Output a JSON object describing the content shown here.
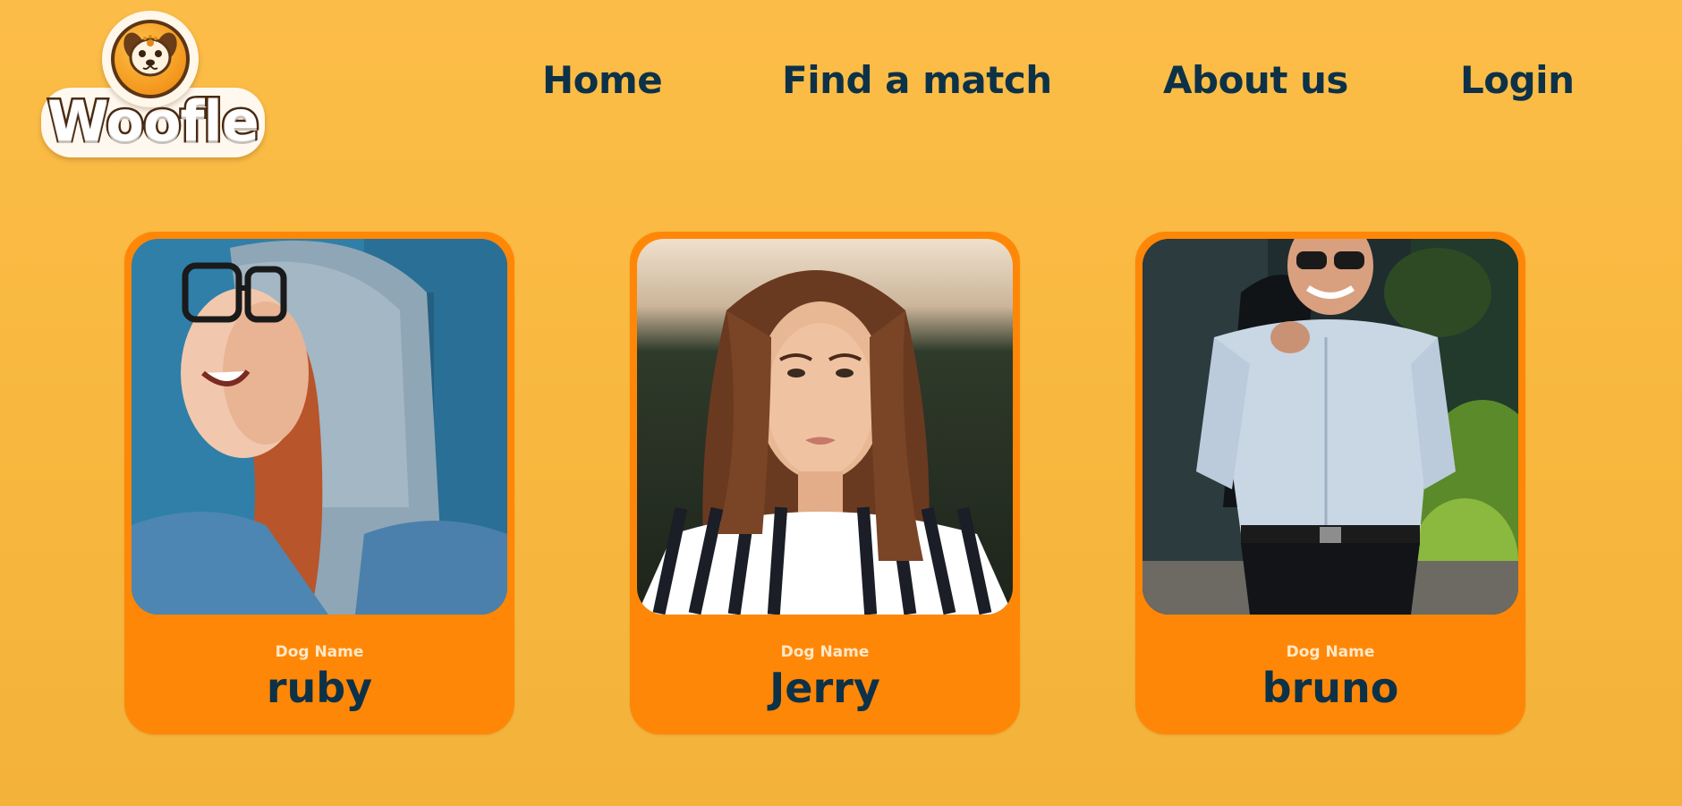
{
  "brand": {
    "logo_text": "Woofle"
  },
  "nav": {
    "items": [
      {
        "label": "Home"
      },
      {
        "label": "Find a match"
      },
      {
        "label": "About us"
      },
      {
        "label": "Login"
      }
    ]
  },
  "cards": [
    {
      "caption": "Dog Name",
      "name": "ruby"
    },
    {
      "caption": "Dog Name",
      "name": "Jerry"
    },
    {
      "caption": "Dog Name",
      "name": "bruno"
    }
  ],
  "colors": {
    "background": "#fcbd48",
    "card": "#ff8707",
    "text_dark": "#0d3247",
    "caption": "#ffe9c8"
  }
}
